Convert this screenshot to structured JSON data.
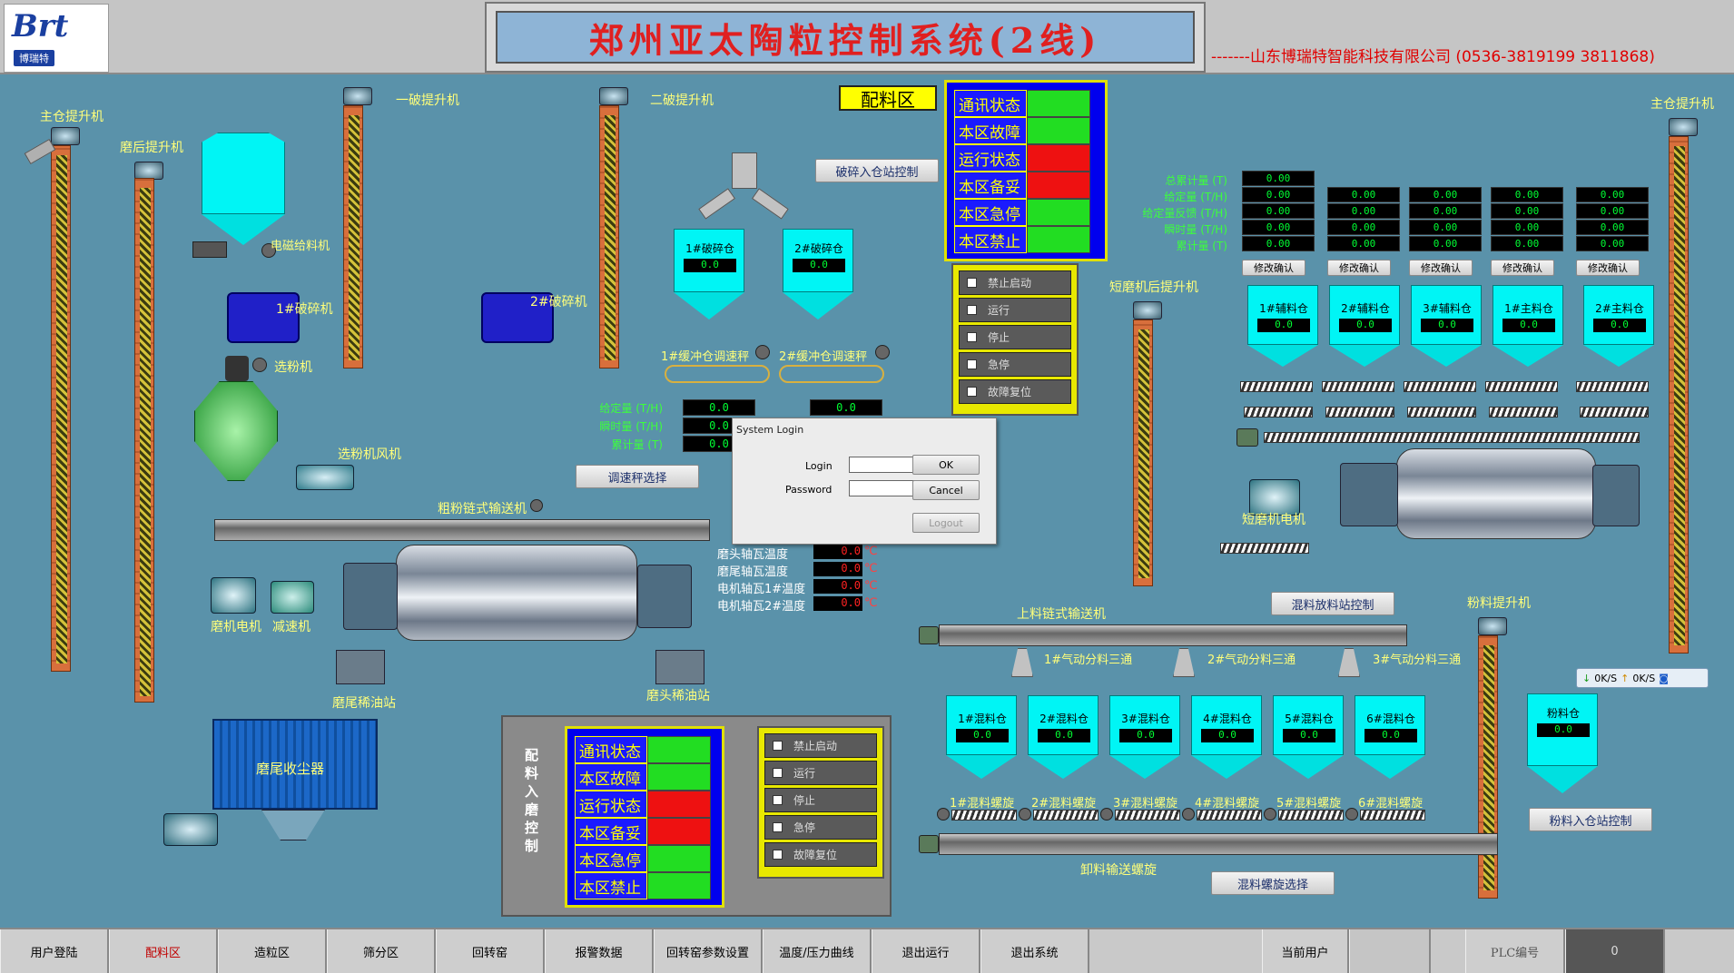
{
  "header": {
    "logo_text": "Brt",
    "logo_sub": "博瑞特",
    "title": "郑州亚太陶粒控制系统(2线)",
    "company": "-------山东博瑞特智能科技有限公司  (0536-3819199  3811868)"
  },
  "equipment_labels": {
    "main_elevator_left": "主仓提升机",
    "grind_elevator": "磨后提升机",
    "crusher1_elevator": "一破提升机",
    "crusher2_elevator": "二破提升机",
    "magnetic_feeder": "电磁给料机",
    "crusher1": "1#破碎机",
    "crusher2": "2#破碎机",
    "separator": "选粉机",
    "separator_fan": "选粉机风机",
    "coarse_conveyor": "粗粉链式输送机",
    "mill_motor": "磨机电机",
    "reducer": "减速机",
    "tail_oil": "磨尾稀油站",
    "head_oil": "磨头稀油站",
    "dust_collector": "磨尾收尘器",
    "short_mill_elevator": "短磨机后提升机",
    "short_mill_motor": "短磨机电机",
    "main_elevator_right": "主仓提升机",
    "upper_conveyor": "上料链式输送机",
    "powder_elevator": "粉料提升机",
    "unload_screw": "卸料输送螺旋",
    "buffer1": "1#缓冲仓调速秤",
    "buffer2": "2#缓冲仓调速秤",
    "tee1": "1#气动分料三通",
    "tee2": "2#气动分料三通",
    "tee3": "3#气动分料三通",
    "batching_area": "配料区",
    "mill_control_title": "配料入磨控制"
  },
  "buttons": {
    "crush_in_control": "破碎入仓站控制",
    "scale_select": "调速秤选择",
    "mix_discharge_control": "混料放料站控制",
    "powder_in_control": "粉料入仓站控制",
    "mix_screw_select": "混料螺旋选择",
    "confirm": "修改确认"
  },
  "crush_silos": [
    {
      "label": "1#破碎仓",
      "value": "0.0"
    },
    {
      "label": "2#破碎仓",
      "value": "0.0"
    }
  ],
  "feed_labels": {
    "given": "给定量 (T/H)",
    "instant": "瞬时量 (T/H)",
    "total": "累计量 (T)"
  },
  "feed_values": {
    "left": [
      "0.0",
      "0.0",
      "0.0"
    ],
    "right": [
      "0.0"
    ]
  },
  "batch_labels": [
    "总累计量 (T)",
    "给定量 (T/H)",
    "给定量反馈 (T/H)",
    "瞬时量 (T/H)",
    "累计量 (T)"
  ],
  "batch_values": [
    [
      "0.00",
      "0.00",
      "0.00",
      "0.00",
      "0.00"
    ],
    [
      "0.00",
      "0.00",
      "0.00",
      "0.00"
    ],
    [
      "0.00",
      "0.00",
      "0.00",
      "0.00"
    ],
    [
      "0.00",
      "0.00",
      "0.00",
      "0.00"
    ],
    [
      "0.00",
      "0.00",
      "0.00",
      "0.00"
    ]
  ],
  "batch_silos": [
    {
      "label": "1#辅料仓",
      "value": "0.0"
    },
    {
      "label": "2#辅料仓",
      "value": "0.0"
    },
    {
      "label": "3#辅料仓",
      "value": "0.0"
    },
    {
      "label": "1#主料仓",
      "value": "0.0"
    },
    {
      "label": "2#主料仓",
      "value": "0.0"
    }
  ],
  "mix_silos": [
    {
      "label": "1#混料仓",
      "value": "0.0",
      "screw": "1#混料螺旋"
    },
    {
      "label": "2#混料仓",
      "value": "0.0",
      "screw": "2#混料螺旋"
    },
    {
      "label": "3#混料仓",
      "value": "0.0",
      "screw": "3#混料螺旋"
    },
    {
      "label": "4#混料仓",
      "value": "0.0",
      "screw": "4#混料螺旋"
    },
    {
      "label": "5#混料仓",
      "value": "0.0",
      "screw": "5#混料螺旋"
    },
    {
      "label": "6#混料仓",
      "value": "0.0",
      "screw": "6#混料螺旋"
    }
  ],
  "powder_silo": {
    "label": "粉料仓",
    "value": "0.0"
  },
  "temperatures": [
    {
      "label": "磨头轴瓦温度",
      "value": "0.0",
      "unit": "℃"
    },
    {
      "label": "磨尾轴瓦温度",
      "value": "0.0",
      "unit": "℃"
    },
    {
      "label": "电机轴瓦1#温度",
      "value": "0.0",
      "unit": "℃"
    },
    {
      "label": "电机轴瓦2#温度",
      "value": "0.0",
      "unit": "℃"
    }
  ],
  "status_panel_top": [
    {
      "label": "通讯状态",
      "color": "#22dd22"
    },
    {
      "label": "本区故障",
      "color": "#22dd22"
    },
    {
      "label": "运行状态",
      "color": "#ee1111"
    },
    {
      "label": "本区备妥",
      "color": "#ee1111"
    },
    {
      "label": "本区急停",
      "color": "#22dd22"
    },
    {
      "label": "本区禁止",
      "color": "#22dd22"
    }
  ],
  "status_panel_bottom": [
    {
      "label": "通讯状态",
      "color": "#22dd22"
    },
    {
      "label": "本区故障",
      "color": "#22dd22"
    },
    {
      "label": "运行状态",
      "color": "#ee1111"
    },
    {
      "label": "本区备妥",
      "color": "#ee1111"
    },
    {
      "label": "本区急停",
      "color": "#22dd22"
    },
    {
      "label": "本区禁止",
      "color": "#22dd22"
    }
  ],
  "control_checks": [
    "禁止启动",
    "运行",
    "停止",
    "急停",
    "故障复位"
  ],
  "network": {
    "down": "0K/S",
    "up": "0K/S"
  },
  "login_dialog": {
    "title": "System Login",
    "login_label": "Login",
    "password_label": "Password",
    "ok": "OK",
    "cancel": "Cancel",
    "logout": "Logout"
  },
  "nav": [
    {
      "label": "用户登陆",
      "active": false
    },
    {
      "label": "配料区",
      "active": true
    },
    {
      "label": "造粒区",
      "active": false
    },
    {
      "label": "筛分区",
      "active": false
    },
    {
      "label": "回转窑",
      "active": false
    },
    {
      "label": "报警数据",
      "active": false
    },
    {
      "label": "回转窑参数设置",
      "active": false
    },
    {
      "label": "温度/压力曲线",
      "active": false
    },
    {
      "label": "退出运行",
      "active": false
    },
    {
      "label": "退出系统",
      "active": false
    }
  ],
  "footer": {
    "current_user_label": "当前用户",
    "current_user_value": "",
    "plc_label": "PLC编号",
    "plc_value": "0"
  }
}
